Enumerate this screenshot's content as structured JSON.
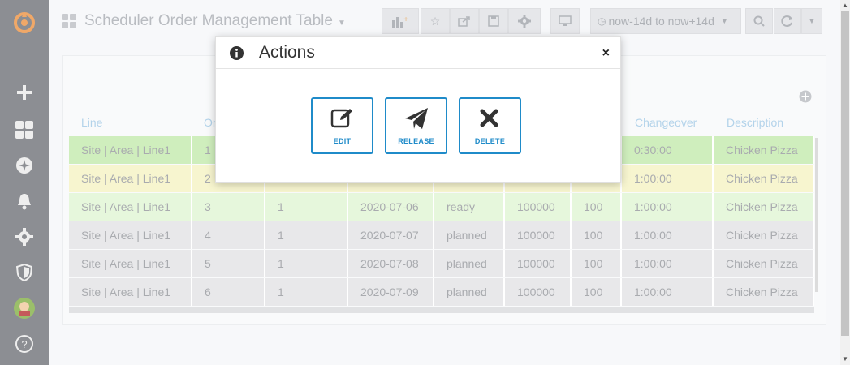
{
  "dashboard": {
    "title": "Scheduler Order Management Table",
    "time_range": "now-14d to now+14d"
  },
  "table": {
    "columns": [
      "Line",
      "Or",
      "Changeover",
      "Description"
    ],
    "rows": [
      {
        "line": "Site | Area | Line1",
        "order": "1",
        "c3": "",
        "c4": "",
        "c5": "",
        "c6": "",
        "c7": "",
        "changeover": "0:30:00",
        "description": "Chicken Pizza",
        "color": "#cfeebd"
      },
      {
        "line": "Site | Area | Line1",
        "order": "2",
        "c3": "",
        "c4": "",
        "c5": "",
        "c6": "",
        "c7": "",
        "changeover": "1:00:00",
        "description": "Chicken Pizza",
        "color": "#f7f5cf"
      },
      {
        "line": "Site | Area | Line1",
        "order": "3",
        "c3": "1",
        "c4": "2020-07-06",
        "c5": "ready",
        "c6": "100000",
        "c7": "100",
        "changeover": "1:00:00",
        "description": "Chicken Pizza",
        "color": "#e6f7dc"
      },
      {
        "line": "Site | Area | Line1",
        "order": "4",
        "c3": "1",
        "c4": "2020-07-07",
        "c5": "planned",
        "c6": "100000",
        "c7": "100",
        "changeover": "1:00:00",
        "description": "Chicken Pizza",
        "color": "#e8e8ea"
      },
      {
        "line": "Site | Area | Line1",
        "order": "5",
        "c3": "1",
        "c4": "2020-07-08",
        "c5": "planned",
        "c6": "100000",
        "c7": "100",
        "changeover": "1:00:00",
        "description": "Chicken Pizza",
        "color": "#e8e8ea"
      },
      {
        "line": "Site | Area | Line1",
        "order": "6",
        "c3": "1",
        "c4": "2020-07-09",
        "c5": "planned",
        "c6": "100000",
        "c7": "100",
        "changeover": "1:00:00",
        "description": "Chicken Pizza",
        "color": "#e8e8ea"
      }
    ]
  },
  "modal": {
    "title": "Actions",
    "close": "×",
    "buttons": {
      "edit": "EDIT",
      "release": "RELEASE",
      "delete": "DELETE"
    }
  },
  "icons": {
    "sidebar": [
      "grafana-logo-icon",
      "plus-icon",
      "dashboards-icon",
      "explore-icon",
      "bell-icon",
      "gear-icon",
      "shield-icon",
      "avatar",
      "help-icon"
    ]
  },
  "colors": {
    "accent": "#1f8bc9",
    "sidebar": "#8c8e93"
  }
}
